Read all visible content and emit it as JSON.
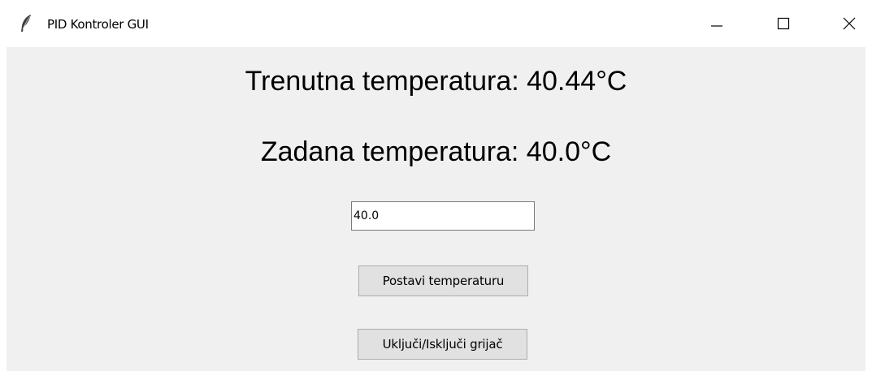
{
  "window": {
    "title": "PID Kontroler GUI",
    "icon": "feather-icon",
    "controls": {
      "minimize_icon": "minimize-icon",
      "maximize_icon": "maximize-icon",
      "close_icon": "close-icon"
    }
  },
  "main": {
    "current_temperature": "Trenutna temperatura: 40.44°C",
    "target_temperature": "Zadana temperatura: 40.0°C",
    "temperature_input": {
      "value": "40.0"
    },
    "set_button_label": "Postavi temperaturu",
    "toggle_heater_label": "Uključi/Isključi grijač"
  },
  "colors": {
    "client_background": "#f0f0f0",
    "button_background": "#e1e1e1",
    "button_border": "#adadad"
  }
}
